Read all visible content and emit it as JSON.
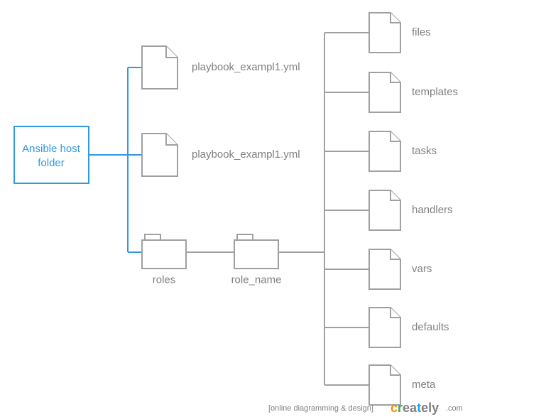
{
  "root": {
    "line1": "Ansible host",
    "line2": "folder"
  },
  "children": [
    {
      "type": "file",
      "label": "playbook_exampl1.yml"
    },
    {
      "type": "file",
      "label": "playbook_exampl1.yml"
    },
    {
      "type": "folder",
      "label": "roles",
      "child": {
        "type": "folder",
        "label": "role_name",
        "children": [
          {
            "type": "file",
            "label": "files"
          },
          {
            "type": "file",
            "label": "templates"
          },
          {
            "type": "file",
            "label": "tasks"
          },
          {
            "type": "file",
            "label": "handlers"
          },
          {
            "type": "file",
            "label": "vars"
          },
          {
            "type": "file",
            "label": "defaults"
          },
          {
            "type": "file",
            "label": "meta"
          }
        ]
      }
    }
  ],
  "footer": {
    "text": "[online diagramming & design]",
    "tail": ".com",
    "brand": [
      "c",
      "r",
      "e",
      "a",
      "t",
      "e",
      "l",
      "y"
    ]
  },
  "colors": {
    "accent": "#2e9ae2",
    "line_gray": "#a0a0a0",
    "text_gray": "#808080"
  }
}
